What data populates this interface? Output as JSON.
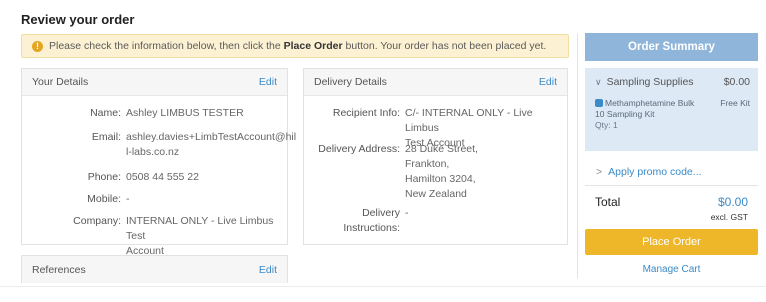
{
  "page": {
    "title": "Review your order"
  },
  "alert": {
    "icon": "exclamation-circle-icon",
    "text_before": "Please check the information below, then click the ",
    "bold": "Place Order",
    "text_after": " button. Your order has not been placed yet."
  },
  "your_details": {
    "title": "Your Details",
    "edit": "Edit",
    "name_label": "Name:",
    "name": "Ashley LIMBUS TESTER",
    "email_label": "Email:",
    "email": "ashley.davies+LimbTestAccount@hil\nl-labs.co.nz",
    "phone_label": "Phone:",
    "phone": "0508 44 555 22",
    "mobile_label": "Mobile:",
    "mobile": "-",
    "company_label": "Company:",
    "company": "INTERNAL ONLY - Live Limbus Test\nAccount"
  },
  "delivery_details": {
    "title": "Delivery Details",
    "edit": "Edit",
    "recipient_label": "Recipient Info:",
    "recipient": "C/- INTERNAL ONLY - Live Limbus\nTest Account",
    "address_label": "Delivery Address:",
    "address": "28 Duke Street,\nFrankton,\nHamilton 3204,\nNew Zealand",
    "instructions_label": "Delivery\nInstructions:",
    "instructions": "-"
  },
  "references": {
    "title": "References",
    "edit": "Edit"
  },
  "summary": {
    "title": "Order Summary",
    "group": "Sampling Supplies",
    "group_price": "$0.00",
    "item_name": "Methamphetamine Bulk 10 Sampling Kit",
    "item_qty": "Qty: 1",
    "item_price": "Free Kit",
    "promo": "Apply promo code...",
    "total_label": "Total",
    "total_value": "$0.00",
    "excl_gst": "excl. GST",
    "place_order": "Place Order",
    "manage_cart": "Manage Cart"
  },
  "colors": {
    "accent_blue": "#3b8bc8",
    "summary_header": "#8fb5da",
    "place_order": "#eeb72a",
    "alert_bg": "#fcf2d3"
  }
}
